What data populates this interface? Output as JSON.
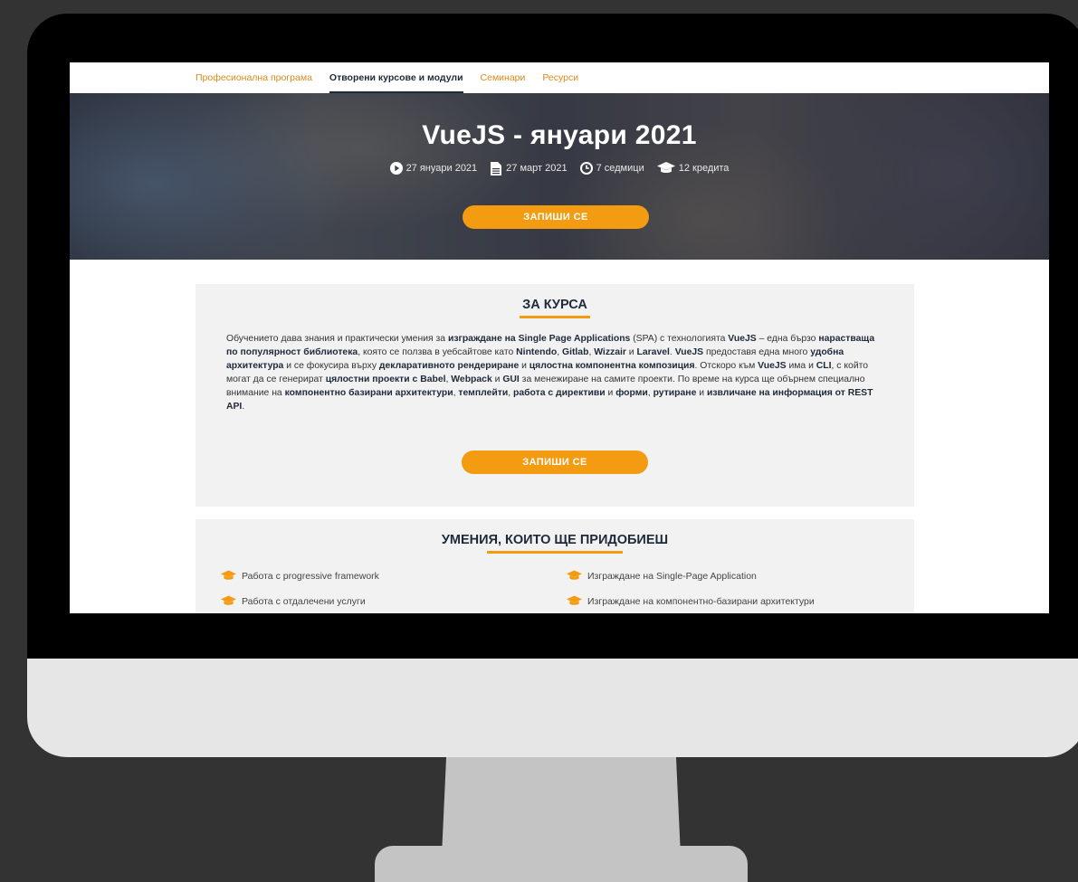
{
  "nav": {
    "items": [
      {
        "label": "Професионална програма"
      },
      {
        "label": "Отворени курсове и модули"
      },
      {
        "label": "Семинари"
      },
      {
        "label": "Ресурси"
      }
    ]
  },
  "hero": {
    "title": "VueJS - януари 2021",
    "start_date": "27 януари 2021",
    "end_date": "27 март 2021",
    "duration": "7 седмици",
    "credits": "12 кредита",
    "cta_label": "ЗАПИШИ СЕ"
  },
  "about": {
    "title": "ЗА КУРСА",
    "cta_label": "ЗАПИШИ СЕ",
    "paragraph": [
      {
        "t": "Обучението дава знания и практически умения за ",
        "b": false
      },
      {
        "t": "изграждане на Single Page Applications",
        "b": true
      },
      {
        "t": " (SPA) с технологията ",
        "b": false
      },
      {
        "t": "VueJS",
        "b": true
      },
      {
        "t": " – една бързо ",
        "b": false
      },
      {
        "t": "нарастваща по популярност библиотека",
        "b": true
      },
      {
        "t": ", която се ползва в уебсайтове като ",
        "b": false
      },
      {
        "t": "Nintendo",
        "b": true
      },
      {
        "t": ", ",
        "b": false
      },
      {
        "t": "Gitlab",
        "b": true
      },
      {
        "t": ", ",
        "b": false
      },
      {
        "t": "Wizzair",
        "b": true
      },
      {
        "t": " и ",
        "b": false
      },
      {
        "t": "Laravel",
        "b": true
      },
      {
        "t": ". ",
        "b": false
      },
      {
        "t": "VueJS",
        "b": true
      },
      {
        "t": " предоставя една много ",
        "b": false
      },
      {
        "t": "удобна архитектура",
        "b": true
      },
      {
        "t": " и се фокусира върху ",
        "b": false
      },
      {
        "t": "декларативното рендериране",
        "b": true
      },
      {
        "t": " и ",
        "b": false
      },
      {
        "t": "цялостна компонентна композиция",
        "b": true
      },
      {
        "t": ". Отскоро към ",
        "b": false
      },
      {
        "t": "VueJS",
        "b": true
      },
      {
        "t": " има и ",
        "b": false
      },
      {
        "t": "CLI",
        "b": true
      },
      {
        "t": ", с който могат да се генерират ",
        "b": false
      },
      {
        "t": "цялостни проекти с Babel",
        "b": true
      },
      {
        "t": ", ",
        "b": false
      },
      {
        "t": "Webpack",
        "b": true
      },
      {
        "t": " и ",
        "b": false
      },
      {
        "t": "GUI",
        "b": true
      },
      {
        "t": " за менежиране на самите проекти. По време на курса ще обърнем специално внимание на ",
        "b": false
      },
      {
        "t": "компонентно базирани архитектури",
        "b": true
      },
      {
        "t": ", ",
        "b": false
      },
      {
        "t": "темплейти",
        "b": true
      },
      {
        "t": ", ",
        "b": false
      },
      {
        "t": "работа с директиви",
        "b": true
      },
      {
        "t": " и ",
        "b": false
      },
      {
        "t": "форми",
        "b": true
      },
      {
        "t": ", ",
        "b": false
      },
      {
        "t": "рутиране",
        "b": true
      },
      {
        "t": " и ",
        "b": false
      },
      {
        "t": "извличане на информация от REST API",
        "b": true
      },
      {
        "t": ".",
        "b": false
      }
    ]
  },
  "skills": {
    "title": "УМЕНИЯ, КОИТО ЩЕ ПРИДОБИЕШ",
    "items": [
      "Работа с progressive framework",
      "Изграждане на Single-Page Application",
      "Работа с отдалечени услуги",
      "Изграждане на компонентно-базирани архитектури"
    ]
  },
  "colors": {
    "accent": "#f39c12",
    "nav_link": "#d98a1b",
    "heading": "#1e2a3a",
    "card_bg": "#f2f2f2"
  }
}
